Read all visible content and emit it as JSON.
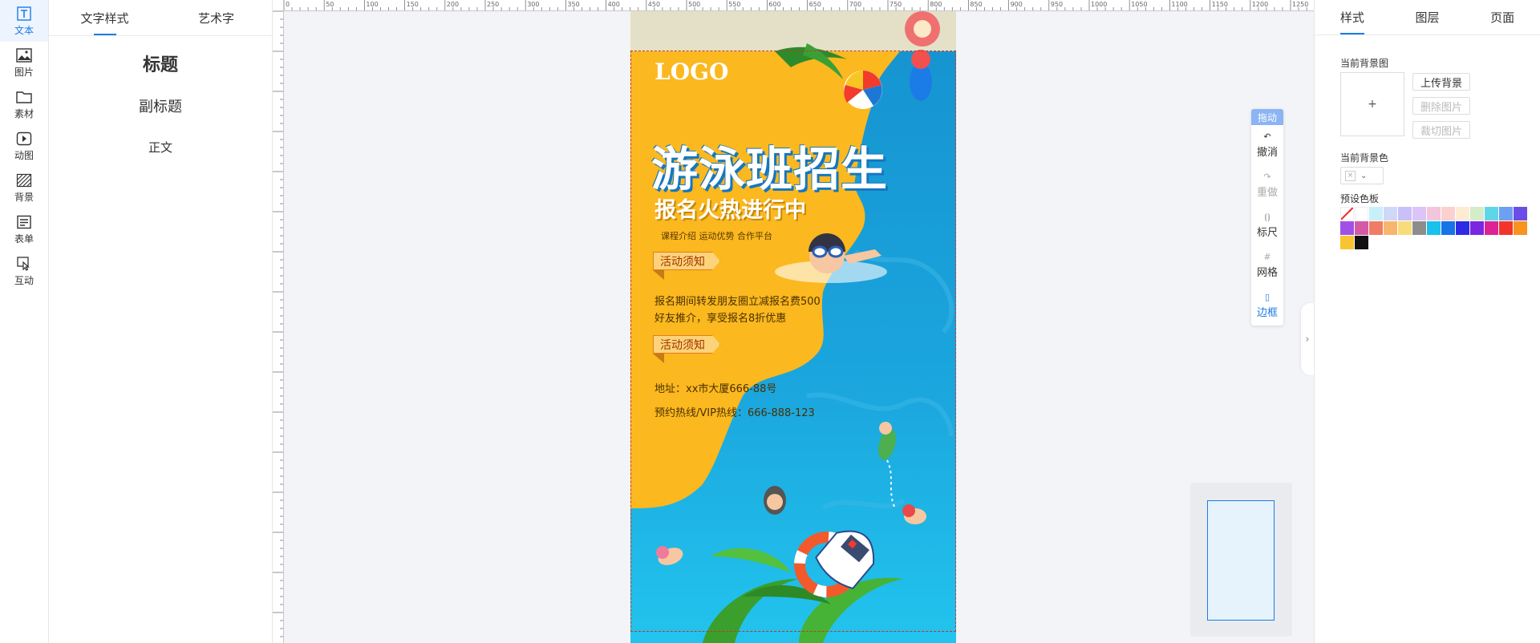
{
  "left_nav": [
    {
      "label": "文本",
      "icon": "text-icon"
    },
    {
      "label": "图片",
      "icon": "image-icon"
    },
    {
      "label": "素材",
      "icon": "folder-icon"
    },
    {
      "label": "动图",
      "icon": "animation-icon"
    },
    {
      "label": "背景",
      "icon": "background-icon"
    },
    {
      "label": "表单",
      "icon": "form-icon"
    },
    {
      "label": "互动",
      "icon": "interaction-icon"
    }
  ],
  "text_panel": {
    "tabs": [
      "文字样式",
      "艺术字"
    ],
    "items": [
      "标题",
      "副标题",
      "正文"
    ]
  },
  "ruler": {
    "top_labels": [
      "0",
      "50",
      "100",
      "150",
      "200",
      "250",
      "300",
      "350",
      "400",
      "450",
      "500",
      "550",
      "600",
      "650",
      "700",
      "750",
      "800",
      "850",
      "900",
      "950",
      "1000",
      "1050",
      "1100",
      "1150",
      "1200",
      "1250"
    ]
  },
  "poster": {
    "logo": "LOGO",
    "headline": "游泳班招生",
    "subheadline": "报名火热进行中",
    "tagline": "课程介绍 运动优势 合作平台",
    "notice_tag_1": "活动须知",
    "notice_text_line1": "报名期间转发朋友圈立减报名费500",
    "notice_text_line2": "好友推介，享受报名8折优惠",
    "notice_tag_2": "活动须知",
    "address": "地址：xx市大厦666-88号",
    "hotline": "预约热线/VIP热线：666-888-123"
  },
  "toolbox": {
    "handle": "拖动",
    "buttons": [
      {
        "label": "撤消",
        "icon": "undo-icon"
      },
      {
        "label": "重做",
        "icon": "redo-icon"
      },
      {
        "label": "标尺",
        "icon": "ruler-icon"
      },
      {
        "label": "网格",
        "icon": "grid-icon"
      },
      {
        "label": "边框",
        "icon": "border-icon"
      }
    ]
  },
  "right_panel": {
    "tabs": [
      "样式",
      "图层",
      "页面"
    ],
    "current_bg_image_label": "当前背景图",
    "upload_plus": "+",
    "upload_bg_button": "上传背景",
    "delete_image_button": "删除图片",
    "crop_image_button": "裁切图片",
    "current_bg_color_label": "当前背景色",
    "preset_palette_label": "预设色板",
    "palette_colors": [
      "none",
      "#ffffff",
      "#c8f0fb",
      "#cfd8f9",
      "#c9c0f9",
      "#dcc4f6",
      "#f3c5dd",
      "#fbd0cf",
      "#fdebd3",
      "#d4ecc8",
      "#5fd5e8",
      "#6d9ff2",
      "#6b4ee6",
      "#a150e6",
      "#d45aa5",
      "#f17c66",
      "#f9b56d",
      "#f7dc7a",
      "#8d8d8d",
      "#19c1ec",
      "#1773e6",
      "#2e2be6",
      "#7a27e0",
      "#db2396",
      "#f2342b",
      "#f7931e",
      "#f8c431",
      "#111111"
    ]
  }
}
